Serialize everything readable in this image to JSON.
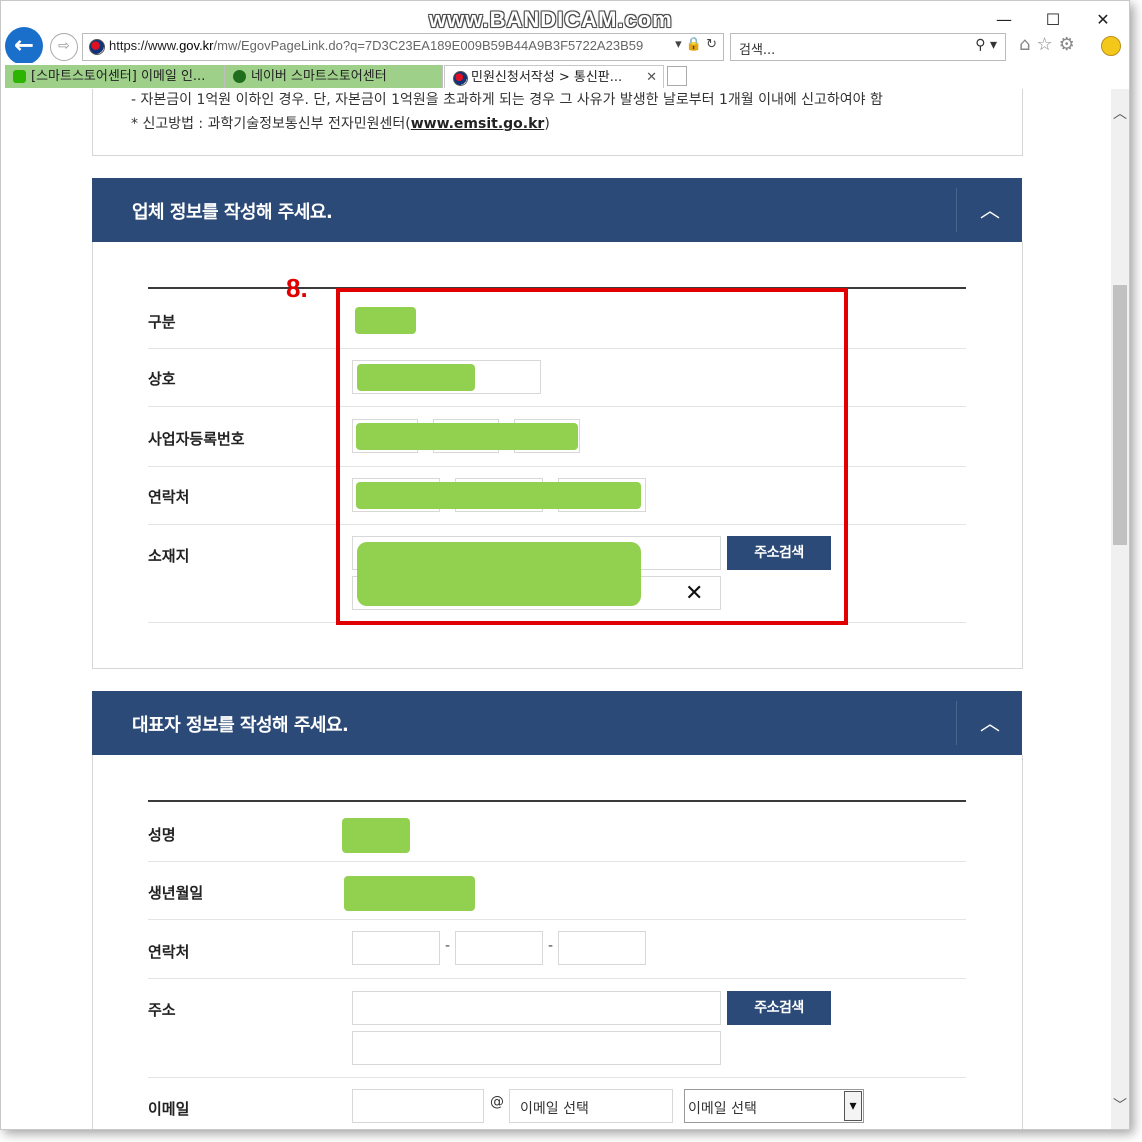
{
  "browser": {
    "watermark": "www.BANDICAM.com",
    "url_prefix": "https://www.",
    "url_domain": "gov.kr",
    "url_rest": "/mw/EgovPageLink.do?q=7D3C23EA189E009B59B44A9B3F5722A23B59",
    "search_placeholder": "검색...",
    "tabs": [
      {
        "label": "[스마트스토어센터] 이메일 인..."
      },
      {
        "label": "네이버 스마트스토어센터"
      },
      {
        "label": "민원신청서작성 > 통신판..."
      }
    ],
    "window": {
      "minimize": "—",
      "maximize": "☐",
      "close": "✕"
    }
  },
  "notice": {
    "line1": "- 자본금이 1억원 이하인 경우. 단, 자본금이 1억원을 초과하게 되는 경우 그 사유가 발생한 날로부터 1개월 이내에 신고하여야 함",
    "line2_prefix": "* 신고방법 : 과학기술정보통신부 전자민원센터(",
    "line2_link": "www.emsit.go.kr",
    "line2_suffix": ")"
  },
  "company_section": {
    "title": "업체 정보를 작성해 주세요.",
    "step_label": "8.",
    "fields": {
      "type": "구분",
      "name": "상호",
      "biz_no": "사업자등록번호",
      "contact": "연락처",
      "address": "소재지"
    },
    "address_button": "주소검색",
    "clear_mark": "✕"
  },
  "rep_section": {
    "title": "대표자 정보를 작성해 주세요.",
    "fields": {
      "name": "성명",
      "birth": "생년월일",
      "contact": "연락처",
      "address": "주소",
      "email": "이메일"
    },
    "address_button": "주소검색",
    "dash": "-",
    "at": "@",
    "email_domain_placeholder": "이메일 선택",
    "email_select": "이메일 선택"
  },
  "colors": {
    "header_navy": "#2b4a77",
    "redaction_green": "#92d050",
    "highlight_red": "#e00000"
  }
}
